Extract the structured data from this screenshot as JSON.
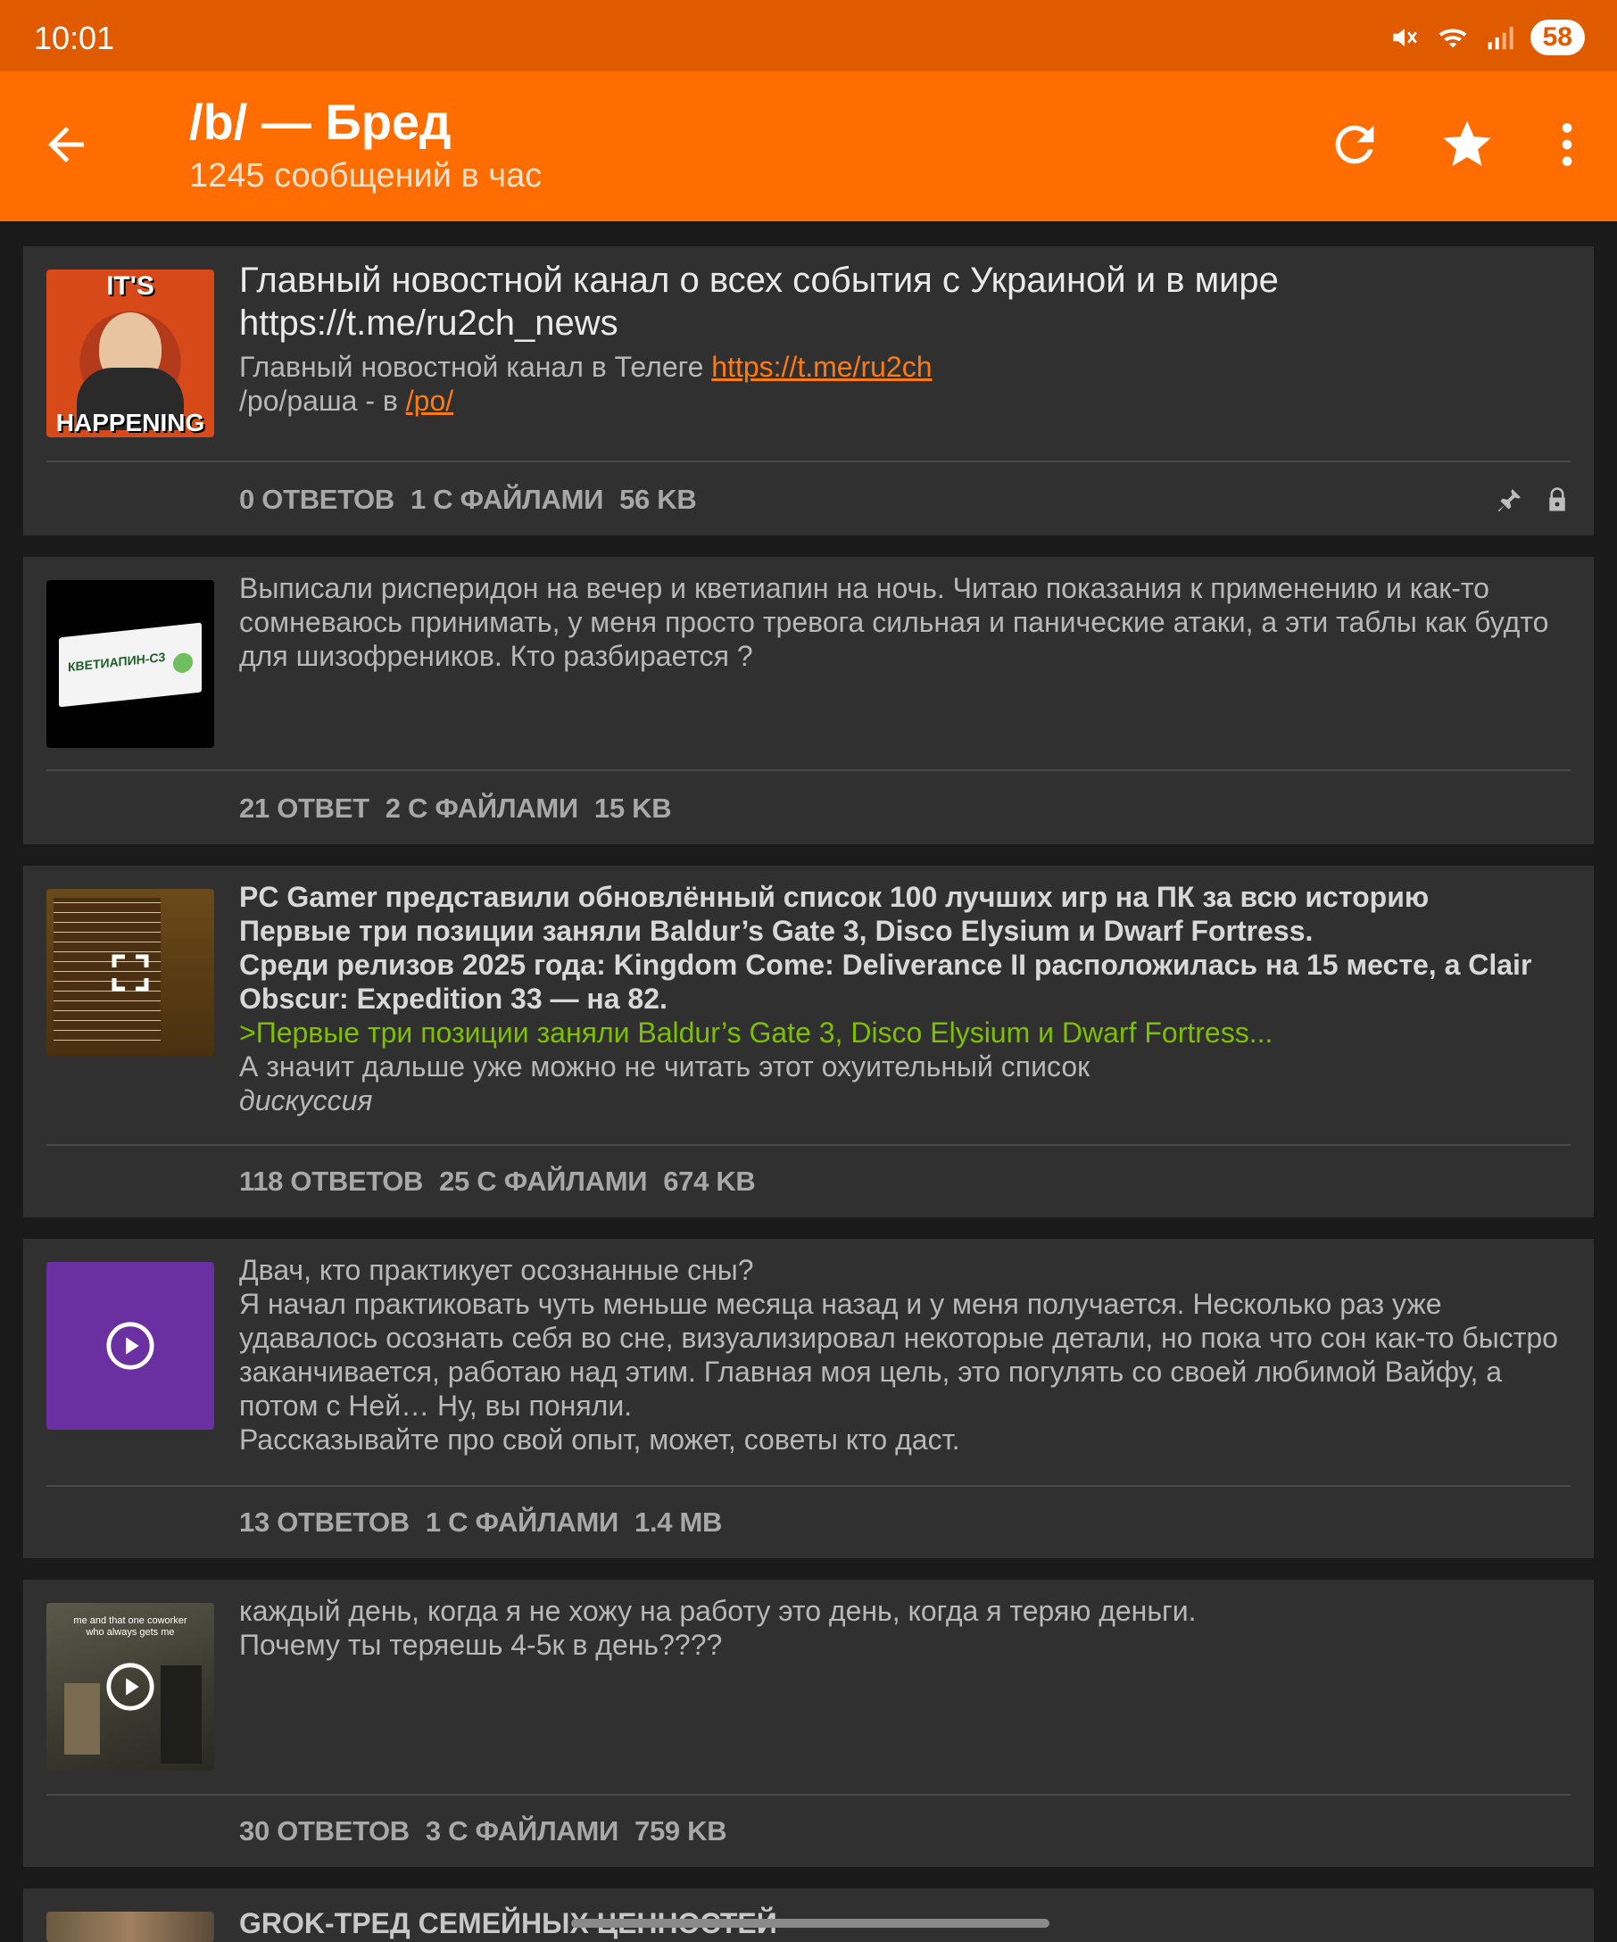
{
  "status_bar": {
    "time": "10:01",
    "battery": "58",
    "icons": [
      "mute-icon",
      "wifi-icon",
      "signal-icon"
    ]
  },
  "app_bar": {
    "title": "/b/ — Бред",
    "subtitle": "1245 сообщений в час",
    "icons": [
      "back-arrow-icon",
      "refresh-icon",
      "star-icon",
      "more-vert-icon"
    ]
  },
  "colors": {
    "status_bar": "#e05a00",
    "app_bar": "#ff6d00",
    "background": "#1a1a1a",
    "card": "#303030",
    "link": "#ff7a10",
    "greentext": "#7cc000"
  },
  "threads": [
    {
      "subject_lines": [
        "Главный новостной канал о всех события с Украиной и в мире",
        "https://t.me/ru2ch_news"
      ],
      "comment_prefix": "Главный новостной канал в Телеге ",
      "comment_link": "https://t.me/ru2ch",
      "comment2_prefix": "/po/раша - в ",
      "comment2_link": "/po/",
      "thumb_top_text": "IT'S",
      "thumb_bottom_text": "HAPPENING",
      "replies": "0 ОТВЕТОВ",
      "files": "1 С ФАЙЛАМИ",
      "size": "56 KB",
      "flags": [
        "pin-icon",
        "lock-icon"
      ]
    },
    {
      "comment": "Выписали рисперидон на вечер и кветиапин на ночь. Читаю показания к применению и как-то сомневаюсь принимать, у меня просто тревога сильная и панические атаки, а эти таблы как будто для шизофреников. Кто разбирается ?",
      "thumb_text": "КВЕТИАПИН-С3",
      "replies": "21 ОТВЕТ",
      "files": "2 С ФАЙЛАМИ",
      "size": "15 KB"
    },
    {
      "bold_lines": [
        "PC Gamer представили обновлённый список 100 лучших игр на ПК за всю историю",
        "Первые три позиции заняли Baldur’s Gate 3, Disco Elysium и Dwarf Fortress.",
        "Среди релизов 2025 года: Kingdom Come: Deliverance II расположилась на 15 месте, а Clair Obscur: Expedition 33 — на 82."
      ],
      "quote": ">Первые три позиции заняли Baldur’s Gate 3, Disco Elysium и Dwarf Fortress...",
      "comment": "А значит дальше уже можно не читать этот охуительный список",
      "italic": "дискуссия",
      "replies": "118 ОТВЕТОВ",
      "files": "25 С ФАЙЛАМИ",
      "size": "674 KB"
    },
    {
      "lines": [
        "Двач, кто практикует осознанные сны?",
        "Я начал практиковать чуть меньше месяца назад и у меня получается. Несколько раз уже удавалось осознать себя во сне, визуализировал некоторые детали, но пока что сон как-то быстро заканчивается, работаю над этим. Главная моя цель, это погулять со своей любимой Вайфу, а потом с Ней… Ну, вы поняли.",
        "Рассказывайте про свой опыт, может, советы кто даст."
      ],
      "replies": "13 ОТВЕТОВ",
      "files": "1 С ФАЙЛАМИ",
      "size": "1.4 MB"
    },
    {
      "lines": [
        "каждый день, когда я не хожу на работу это день, когда я теряю деньги.",
        "Почему ты теряешь 4-5к в день????"
      ],
      "thumb_caption": "me and that one coworker who always gets me",
      "replies": "30 ОТВЕТОВ",
      "files": "3 С ФАЙЛАМИ",
      "size": "759 KB"
    },
    {
      "subject": "GROK-ТРЕД СЕМЕЙНЫХ ЦЕННОСТЕЙ"
    }
  ]
}
